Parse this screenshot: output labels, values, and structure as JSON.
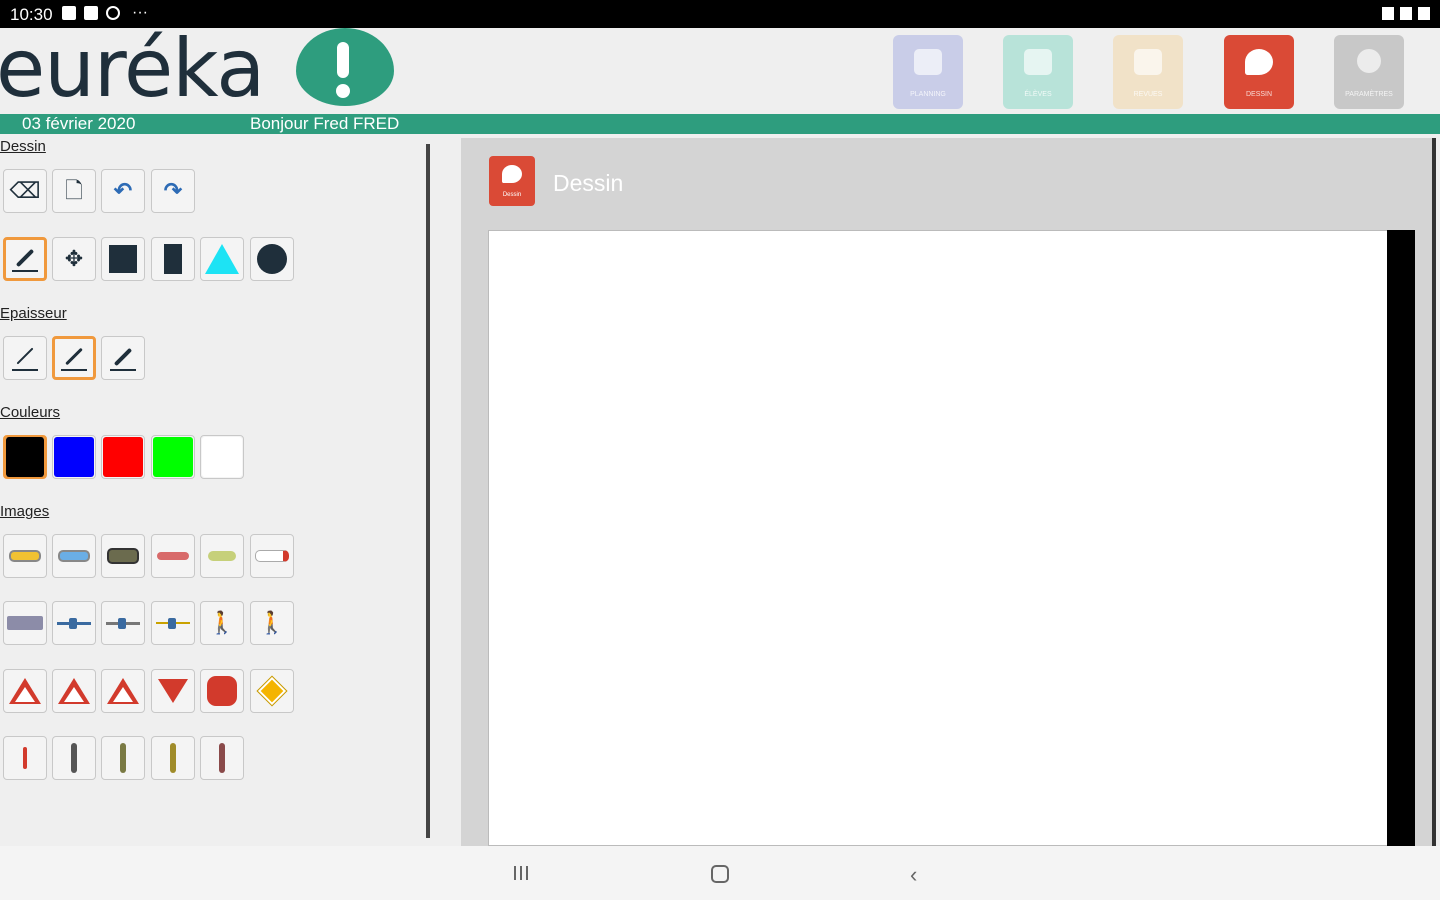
{
  "status_bar": {
    "time": "10:30",
    "more": "···"
  },
  "header": {
    "logo_text": "euréka",
    "nav": [
      {
        "label": "Planning",
        "icon": "calendar-icon"
      },
      {
        "label": "Élèves",
        "icon": "users-icon"
      },
      {
        "label": "Revues",
        "icon": "book-icon"
      },
      {
        "label": "Dessin",
        "icon": "palette-icon"
      },
      {
        "label": "Paramètres",
        "icon": "gear-icon"
      }
    ]
  },
  "info": {
    "date": "03 février 2020",
    "greeting": "Bonjour Fred FRED"
  },
  "tools": {
    "section_dessin": "Dessin",
    "section_epaisseur": "Epaisseur",
    "section_couleurs": "Couleurs",
    "section_images": "Images",
    "colors": [
      "#000000",
      "#0000ff",
      "#ff0000",
      "#00ff00",
      "#ffffff"
    ],
    "selected_color": "#000000",
    "selected_thickness": 2,
    "selected_tool": "pen"
  },
  "panel": {
    "title": "Dessin",
    "icon_label": "Dessin"
  }
}
